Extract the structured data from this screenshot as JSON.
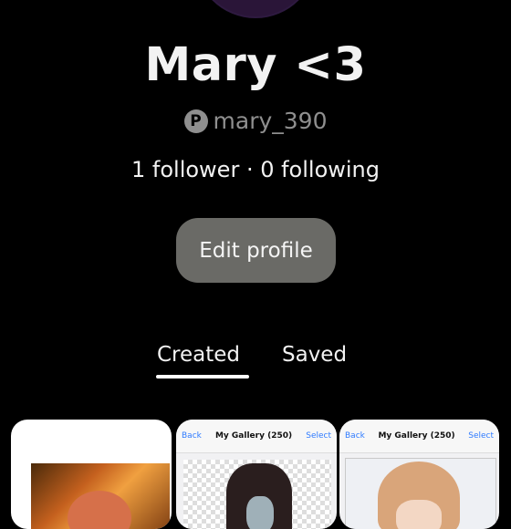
{
  "profile": {
    "display_name": "Mary <3",
    "username": "mary_390",
    "stats": "1 follower · 0 following",
    "edit_button_label": "Edit profile"
  },
  "tabs": [
    {
      "label": "Created",
      "selected": true
    },
    {
      "label": "Saved",
      "selected": false
    }
  ],
  "pins": [
    {
      "header": null
    },
    {
      "header": {
        "back": "Back",
        "title": "My Gallery (250)",
        "select": "Select"
      }
    },
    {
      "header": {
        "back": "Back",
        "title": "My Gallery (250)",
        "select": "Select"
      }
    }
  ],
  "icons": {
    "platform": "pinterest-icon"
  },
  "colors": {
    "background": "#000000",
    "button": "#6a6a66",
    "muted_text": "#8f8f8f"
  }
}
